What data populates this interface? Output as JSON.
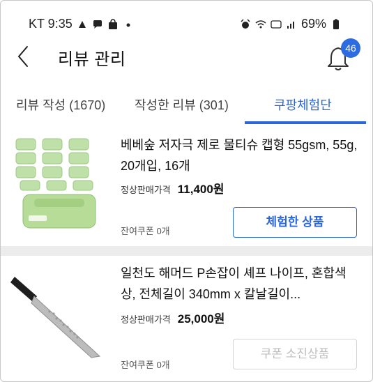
{
  "status_bar": {
    "carrier_time": "KT 9:35",
    "battery": "69%"
  },
  "header": {
    "title": "리뷰 관리",
    "notification_count": "46"
  },
  "tabs": [
    {
      "label": "리뷰 작성 (1670)"
    },
    {
      "label": "작성한 리뷰 (301)"
    },
    {
      "label": "쿠팡체험단",
      "selected": true
    }
  ],
  "items": [
    {
      "name": "베베숲 저자극 제로 물티슈 캡형 55gsm, 55g, 20개입, 16개",
      "price_label": "정상판매가격",
      "price": "11,400원",
      "coupon": "잔여쿠폰 0개",
      "button": "체험한 상품",
      "button_enabled": true
    },
    {
      "name": "일천도 해머드 P손잡이 셰프 나이프, 혼합색상, 전체길이 340mm x 칼날길이...",
      "price_label": "정상판매가격",
      "price": "25,000원",
      "coupon": "잔여쿠폰 0개",
      "button": "쿠폰 소진상품",
      "button_enabled": false
    }
  ],
  "colors": {
    "accent": "#2b67d8",
    "badge": "#2d6be0",
    "disabled": "#bdbdbd"
  }
}
